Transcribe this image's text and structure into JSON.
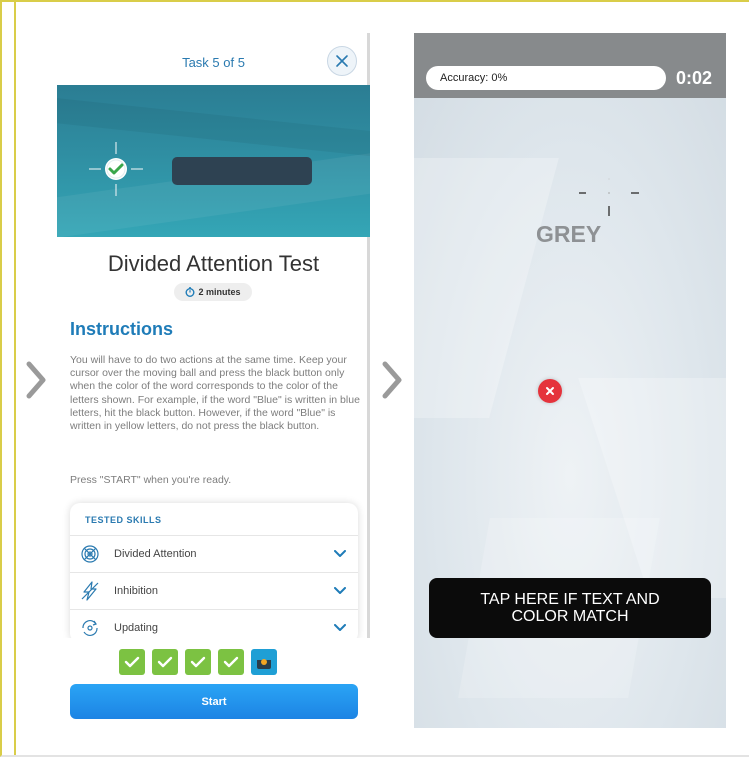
{
  "left_screen": {
    "task_counter": "Task 5 of 5",
    "test_title": "Divided Attention Test",
    "duration": "2 minutes",
    "instructions_heading": "Instructions",
    "instructions_body": "You will have to do two actions at the same time. Keep your cursor over the moving ball and press the black button only when the color of the word corresponds to the color of the letters shown. For example, if the word \"Blue\" is written in blue letters, hit the black button. However, if the word \"Blue\" is written in yellow letters, do not press the black button.",
    "instructions_press": "Press \"START\" when you're ready.",
    "skills_title": "TESTED SKILLS",
    "skills": [
      {
        "label": "Divided Attention",
        "icon": "target-rings-icon"
      },
      {
        "label": "Inhibition",
        "icon": "lightning-slash-icon"
      },
      {
        "label": "Updating",
        "icon": "refresh-eye-icon"
      }
    ],
    "progress": [
      "completed",
      "completed",
      "completed",
      "completed",
      "current"
    ],
    "start_label": "Start"
  },
  "right_screen": {
    "accuracy_label": "Accuracy: 0%",
    "timer": "0:02",
    "stimulus_word": "GREY",
    "tap_button_label": "TAP HERE IF TEXT AND COLOR MATCH"
  },
  "colors": {
    "accent_blue": "#1f7cb8",
    "check_green": "#7cc242",
    "start_blue": "#1d84e4",
    "frame_yellow": "#d9cd49",
    "ball_red": "#e5333c"
  }
}
